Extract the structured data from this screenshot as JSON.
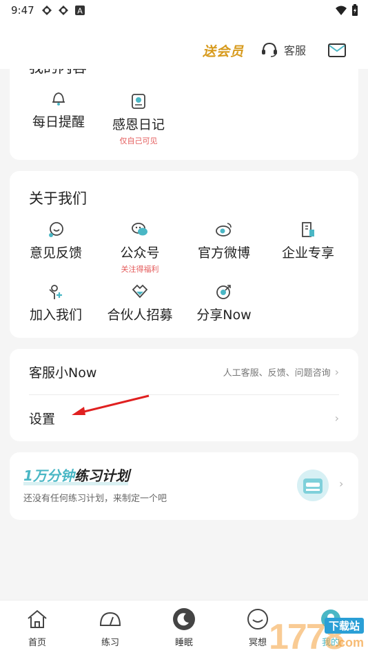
{
  "status_bar": {
    "time": "9:47"
  },
  "header": {
    "vip_label": "送会员",
    "service_label": "客服"
  },
  "my_content": {
    "title": "我的内容",
    "items": [
      {
        "label": "每日提醒",
        "icon": "bell-icon"
      },
      {
        "label": "感恩日记",
        "sub": "仅自己可见",
        "icon": "diary-icon"
      }
    ]
  },
  "about_us": {
    "title": "关于我们",
    "items": [
      {
        "label": "意见反馈",
        "icon": "feedback-icon"
      },
      {
        "label": "公众号",
        "sub": "关注得福利",
        "icon": "wechat-icon"
      },
      {
        "label": "官方微博",
        "icon": "weibo-icon"
      },
      {
        "label": "企业专享",
        "icon": "enterprise-icon"
      },
      {
        "label": "加入我们",
        "icon": "join-icon"
      },
      {
        "label": "合伙人招募",
        "icon": "partner-icon"
      },
      {
        "label": "分享Now",
        "icon": "share-icon"
      }
    ]
  },
  "service_list": {
    "customer_service": {
      "label": "客服小Now",
      "hint": "人工客服、反馈、问题咨询"
    },
    "settings": {
      "label": "设置"
    }
  },
  "plan": {
    "title_highlight": "1万分钟",
    "title_rest": "练习计划",
    "subtitle": "还没有任何练习计划，来制定一个吧"
  },
  "bottom_nav": [
    {
      "label": "首页",
      "icon": "home-icon"
    },
    {
      "label": "练习",
      "icon": "gauge-icon"
    },
    {
      "label": "睡眠",
      "icon": "moon-icon"
    },
    {
      "label": "冥想",
      "icon": "meditation-icon"
    },
    {
      "label": "我的",
      "icon": "profile-icon"
    }
  ],
  "watermark": {
    "number": "1778",
    "site": "下载站",
    "domain": ".com"
  },
  "colors": {
    "accent_teal": "#4ab7c5",
    "vip_gold": "#d79a1c",
    "sub_red": "#e45a5a",
    "arrow_red": "#e02020"
  }
}
